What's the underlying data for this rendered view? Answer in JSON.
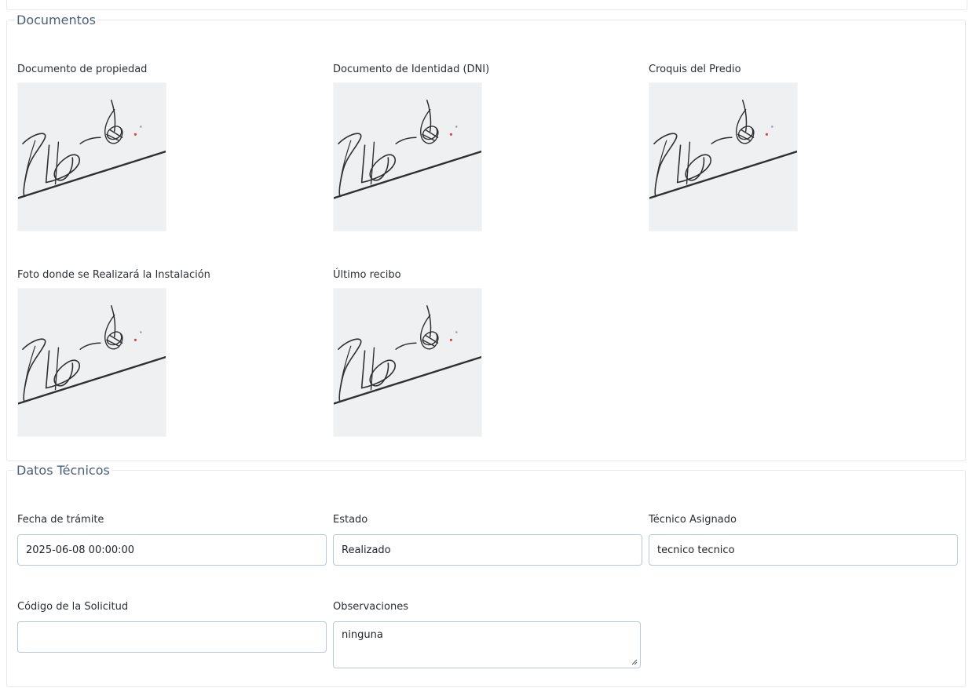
{
  "documents": {
    "legend": "Documentos",
    "items": [
      {
        "label": "Documento de propiedad",
        "image": "signature-image"
      },
      {
        "label": "Documento de Identidad (DNI)",
        "image": "signature-image"
      },
      {
        "label": "Croquis del Predio",
        "image": "signature-image"
      },
      {
        "label": "Foto donde se Realizará la Instalación",
        "image": "signature-image"
      },
      {
        "label": "Último recibo",
        "image": "signature-image"
      }
    ]
  },
  "technical": {
    "legend": "Datos Técnicos",
    "fecha": {
      "label": "Fecha de trámite",
      "value": "2025-06-08 00:00:00"
    },
    "estado": {
      "label": "Estado",
      "value": "Realizado"
    },
    "tecnico": {
      "label": "Técnico Asignado",
      "value": "tecnico tecnico"
    },
    "codigo": {
      "label": "Código de la Solicitud",
      "value": ""
    },
    "observaciones": {
      "label": "Observaciones",
      "value": "ninguna"
    }
  },
  "colors": {
    "legend_text": "#4b5e78",
    "input_border": "#b9c6dd",
    "thumbnail_bg": "#eef0f2",
    "ink": "#2f2f2f",
    "red_dot": "#d94141"
  }
}
